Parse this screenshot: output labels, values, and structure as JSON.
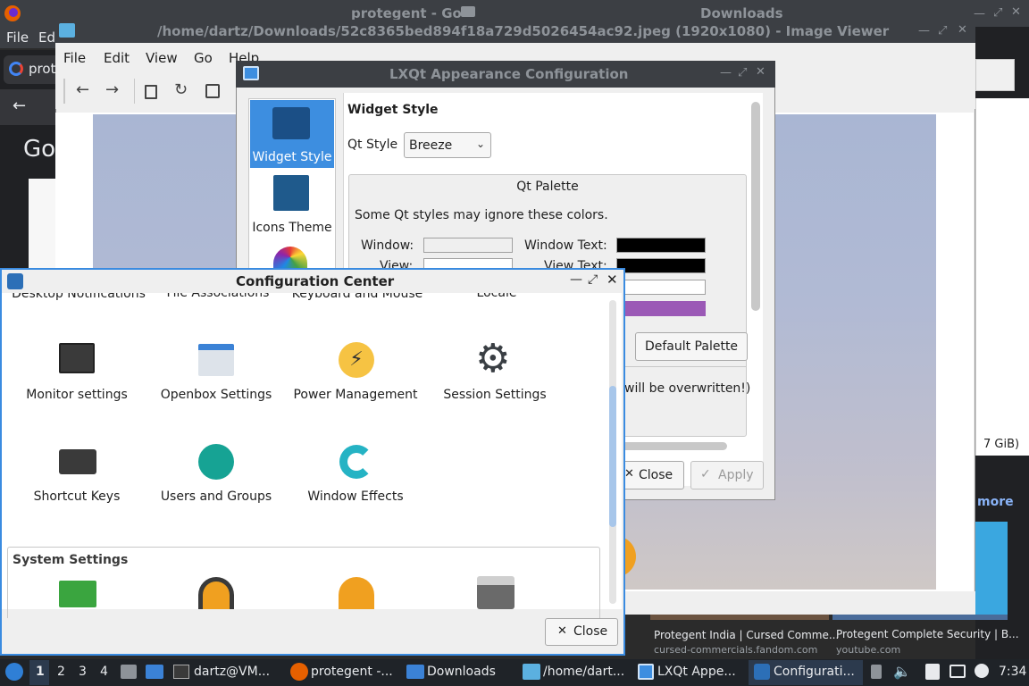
{
  "firefox": {
    "title_left": "protegent - Go",
    "title_right": "Downloads",
    "menu": [
      "File",
      "Ed"
    ],
    "tab_label": "prot",
    "logo_letter": "Go",
    "right_text": "7 GiB)",
    "more_link": "more",
    "cards": [
      {
        "title": "Protegent India | Cursed Comme...",
        "source": "cursed-commercials.fandom.com"
      },
      {
        "title": "Protegent Complete Security | B...",
        "source": "youtube.com"
      }
    ]
  },
  "image_viewer": {
    "title": "/home/dartz/Downloads/52c8365bed894f18a729d5026454ac92.jpeg (1920x1080) - Image Viewer",
    "menu": [
      "File",
      "Edit",
      "View",
      "Go",
      "Help"
    ]
  },
  "appearance": {
    "title": "LXQt Appearance Configuration",
    "sidebar": [
      "Widget Style",
      "Icons Theme"
    ],
    "section_title": "Widget Style",
    "qt_style_label": "Qt Style",
    "qt_style_value": "Breeze",
    "palette_title": "Qt Palette",
    "palette_note": "Some Qt styles may ignore these colors.",
    "window_label": "Window:",
    "window_text_label": "Window Text:",
    "view_label": "View:",
    "view_text_label": "View Text:",
    "default_palette": "Default Palette",
    "overwrite_note": "will be overwritten!)",
    "close": "Close",
    "apply": "Apply",
    "colors": {
      "window": "#efefef",
      "window_text": "#000000",
      "view": "#ffffff",
      "view_text": "#000000",
      "highlight": "#9b59b6"
    }
  },
  "config_center": {
    "title": "Configuration Center",
    "cut_row": [
      "Desktop Notifications",
      "File Associations",
      "Keyboard and Mouse",
      "Locale"
    ],
    "row1": [
      "Monitor settings",
      "Openbox Settings",
      "Power Management",
      "Session Settings"
    ],
    "row2": [
      "Shortcut Keys",
      "Users and Groups",
      "Window Effects"
    ],
    "system_group": "System Settings",
    "close": "Close"
  },
  "taskbar": {
    "desktops": [
      "1",
      "2",
      "3",
      "4"
    ],
    "tasks": [
      "dartz@VM...",
      "protegent -...",
      "Downloads",
      "/home/dart...",
      "LXQt Appe...",
      "Configurati..."
    ],
    "clock": "7:34"
  }
}
